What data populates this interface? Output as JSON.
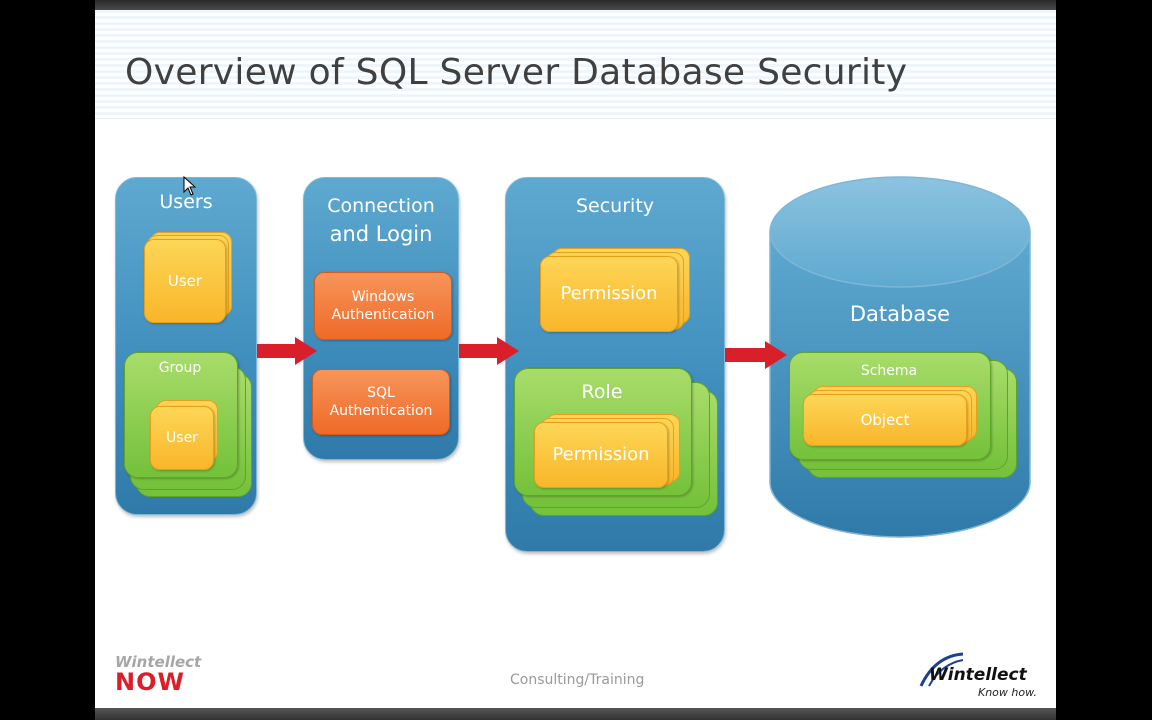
{
  "slide": {
    "title": "Overview of SQL Server Database Security",
    "footer": "Consulting/Training"
  },
  "users": {
    "label": "Users",
    "user_card": "User",
    "group_label": "Group",
    "group_user_card": "User"
  },
  "connection": {
    "label_line1": "Connection",
    "label_line2": "and Login",
    "windows_line1": "Windows",
    "windows_line2": "Authentication",
    "sql_line1": "SQL",
    "sql_line2": "Authentication"
  },
  "security": {
    "label": "Security",
    "permission": "Permission",
    "role_label": "Role",
    "role_permission": "Permission"
  },
  "database": {
    "label": "Database",
    "schema_label": "Schema",
    "object": "Object"
  },
  "logos": {
    "left_top": "Wintellect",
    "left_bottom": "NOW",
    "right_name": "Wintellect",
    "right_tagline": "Know how."
  },
  "colors": {
    "column_blue": "#3f8ebd",
    "card_yellow": "#f9b62a",
    "card_orange": "#ef6a28",
    "card_green": "#74c13a",
    "arrow_red": "#d9202a",
    "logo_red": "#d9202a",
    "logo_blue": "#1f3f8f"
  }
}
